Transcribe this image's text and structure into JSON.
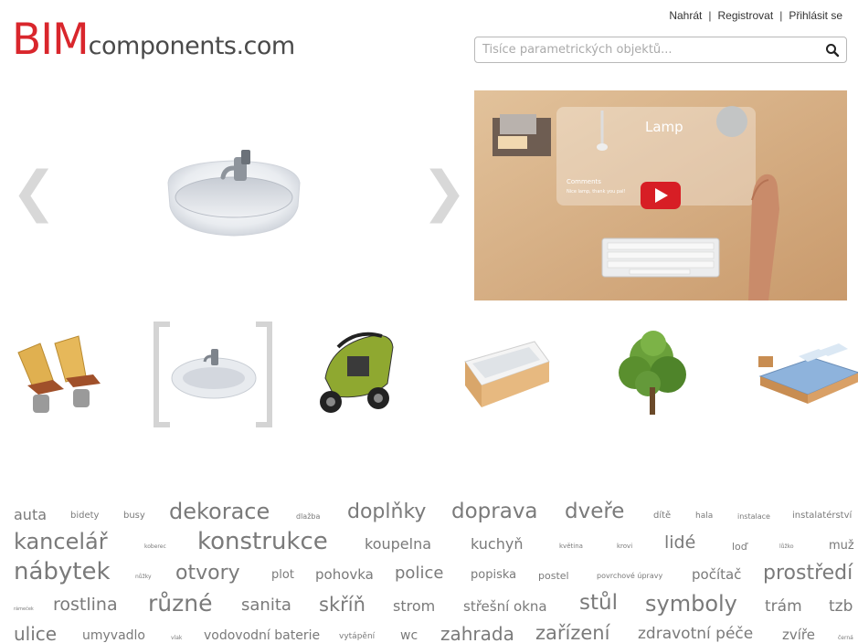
{
  "header": {
    "links": [
      "Nahrát",
      "Registrovat",
      "Přihlásit se"
    ],
    "logo_bim": "BIM",
    "logo_rest": "components.com"
  },
  "search": {
    "placeholder": "Tisíce parametrických objektů...",
    "icon": "search-icon"
  },
  "carousel": {
    "left_arrow": "❮",
    "right_arrow": "❯"
  },
  "video": {
    "overlay_title": "Lamp",
    "comments_heading": "Comments",
    "comment_text": "Nice lamp, thank you pal!",
    "play_icon": "play-icon"
  },
  "thumbnails": [
    "chairs",
    "sink",
    "scooter",
    "bathtub",
    "tree",
    "bed"
  ],
  "tags": [
    "auta",
    "bidety",
    "busy",
    "dekorace",
    "dlažba",
    "doplňky",
    "doprava",
    "dveře",
    "dítě",
    "hala",
    "instalace",
    "instalatérství",
    "kancelář",
    "koberec",
    "konstrukce",
    "koupelna",
    "kuchyň",
    "květina",
    "krovi",
    "lidé",
    "loď",
    "lůžko",
    "muž",
    "nábytek",
    "nůžky",
    "otvory",
    "plot",
    "pohovka",
    "police",
    "popiska",
    "postel",
    "povrchové úpravy",
    "počítač",
    "prostředí",
    "rámeček",
    "rostlina",
    "různé",
    "sanita",
    "skříň",
    "strom",
    "střešní okna",
    "stůl",
    "symboly",
    "trám",
    "tzb",
    "ulice",
    "umyvadlo",
    "vlak",
    "vodovodní baterie",
    "vytápění",
    "wc",
    "zahrada",
    "zařízení",
    "zdravotní péče",
    "zvíře",
    "černá"
  ]
}
